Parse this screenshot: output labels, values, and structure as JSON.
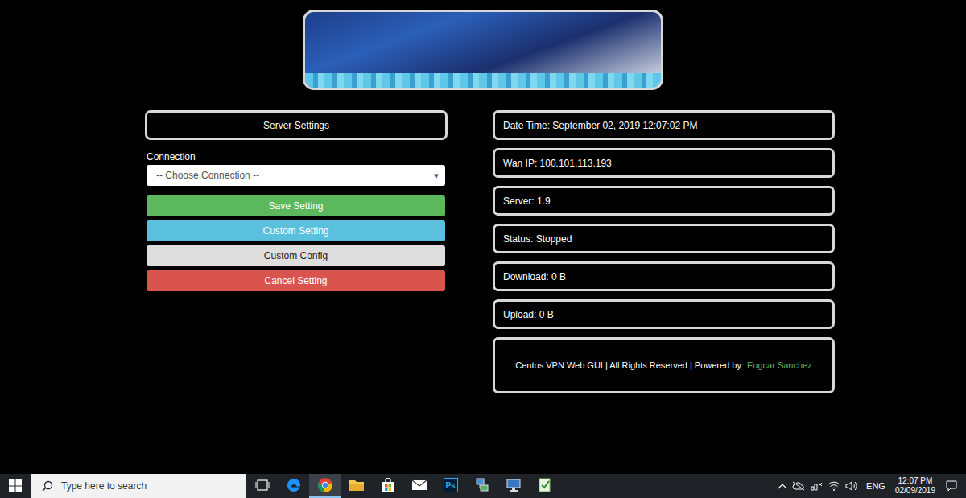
{
  "banner": {
    "kind": "picture"
  },
  "server_settings": {
    "title": "Server Settings"
  },
  "connection": {
    "label": "Connection",
    "placeholder": "-- Choose Connection --",
    "arrow": "▾"
  },
  "buttons": [
    {
      "label": "Save Setting",
      "color": "#5cb85c"
    },
    {
      "label": "Custom Setting",
      "color": "#5bc0de"
    },
    {
      "label": "Custom Config",
      "color": "#dedede"
    },
    {
      "label": "Cancel Setting",
      "color": "#d9534f"
    }
  ],
  "info": [
    "Date Time: September 02, 2019 12:07:02 PM",
    "Wan IP: 100.101.113.193",
    "Server: 1.9",
    "Status: Stopped",
    "Download: 0 B",
    "Upload: 0 B"
  ],
  "footer": {
    "text": "Centos VPN Web GUI | All Rights Reserved | Powered by:",
    "author": "Eugcar Sanchez"
  },
  "taskbar": {
    "search_placeholder": "Type here to search",
    "apps": [
      {
        "kind": "taskview",
        "selected": false
      },
      {
        "kind": "edge",
        "selected": false
      },
      {
        "kind": "chrome",
        "selected": true
      },
      {
        "kind": "explorer",
        "selected": false
      },
      {
        "kind": "store",
        "selected": false
      },
      {
        "kind": "mail",
        "selected": false
      },
      {
        "kind": "photoshop",
        "label": "Ps",
        "selected": false
      },
      {
        "kind": "network",
        "selected": false
      },
      {
        "kind": "remote",
        "selected": false
      },
      {
        "kind": "notepad",
        "selected": false
      }
    ],
    "language": "ENG",
    "time": "12:07 PM",
    "date": "02/09/2019"
  }
}
